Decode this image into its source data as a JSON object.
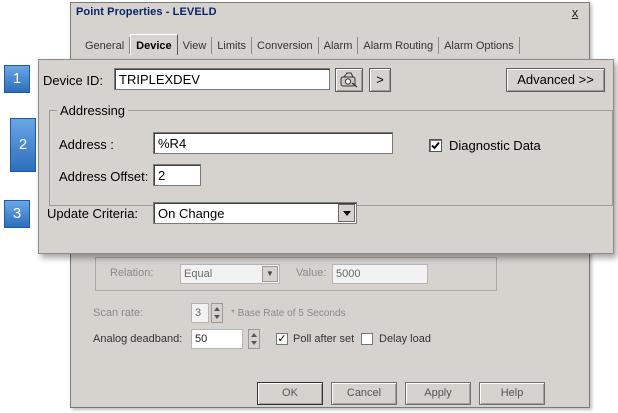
{
  "dialog": {
    "title": "Point Properties - LEVELD",
    "close_glyph": "x",
    "tabs": [
      "General",
      "Device",
      "View",
      "Limits",
      "Conversion",
      "Alarm",
      "Alarm Routing",
      "Alarm Options"
    ],
    "active_tab": "Device",
    "relation_label": "Relation:",
    "relation_value": "Equal",
    "value_label": "Value:",
    "value_value": "5000",
    "scan_rate_label": "Scan rate:",
    "scan_rate_value": "3",
    "scan_rate_note": "* Base Rate of 5 Seconds",
    "deadband_label": "Analog deadband:",
    "deadband_value": "50",
    "poll_after_set_label": "Poll after set",
    "poll_after_set_checked": true,
    "delay_load_label": "Delay load",
    "delay_load_checked": false,
    "buttons": {
      "ok": "OK",
      "cancel": "Cancel",
      "apply": "Apply",
      "help": "Help"
    }
  },
  "callout": {
    "badges": [
      "1",
      "2",
      "3"
    ],
    "device_id_label": "Device ID:",
    "device_id_value": "TRIPLEXDEV",
    "browse_icon": "device-browse-icon",
    "next_button_label": ">",
    "advanced_button_label": "Advanced >>",
    "addressing_group_title": "Addressing",
    "address_label": "Address :",
    "address_value": "%R4",
    "diagnostic_data_label": "Diagnostic Data",
    "diagnostic_data_checked": true,
    "address_offset_label": "Address Offset:",
    "address_offset_value": "2",
    "update_criteria_label": "Update Criteria:",
    "update_criteria_value": "On Change"
  },
  "colors": {
    "face": "#d6d3ce",
    "badge": "#2d6ebc",
    "title_text": "#0a246a"
  }
}
